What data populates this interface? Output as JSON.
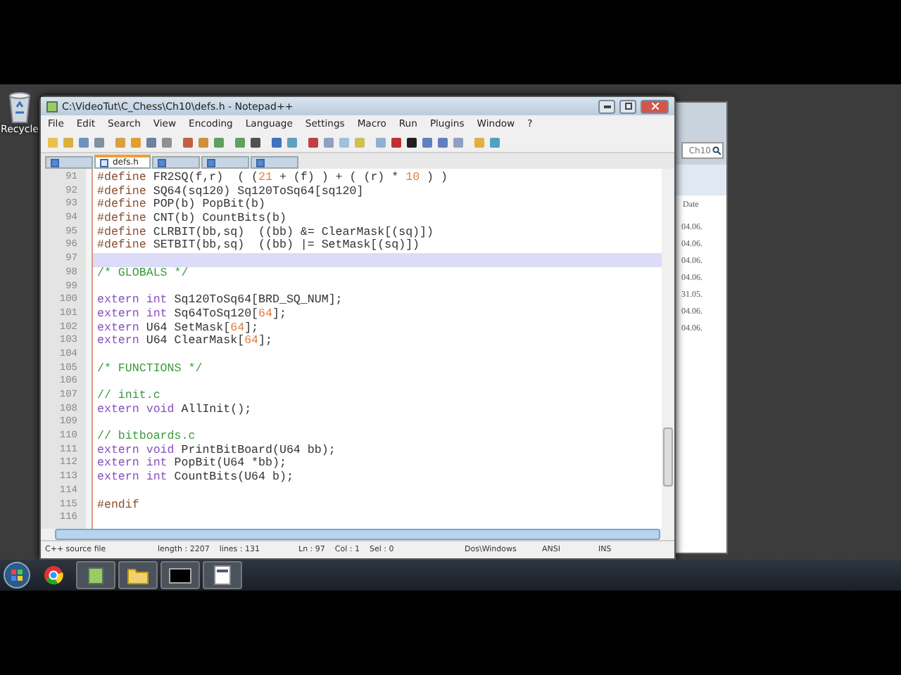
{
  "desktop": {
    "icons": [
      {
        "label": "Recycle"
      }
    ]
  },
  "background_window": {
    "search": "Ch10",
    "column_header": "Date",
    "dates": [
      "04.06.",
      "04.06.",
      "04.06.",
      "04.06.",
      "31.05.",
      "04.06.",
      "04.06."
    ]
  },
  "window": {
    "title": "C:\\VideoTut\\C_Chess\\Ch10\\defs.h - Notepad++"
  },
  "menu": [
    "File",
    "Edit",
    "Search",
    "View",
    "Encoding",
    "Language",
    "Settings",
    "Macro",
    "Run",
    "Plugins",
    "Window",
    "?"
  ],
  "tabs": [
    {
      "selected": false
    },
    {
      "label": "defs.h",
      "selected": true
    },
    {
      "selected": false
    },
    {
      "selected": false
    },
    {
      "selected": false
    }
  ],
  "lines": [
    {
      "num": "91",
      "current": false,
      "segments": [
        {
          "kind": "pre",
          "text": "#define"
        },
        {
          "kind": "plain",
          "text": " FR2SQ(f,r)  ( ("
        },
        {
          "kind": "num",
          "text": "21"
        },
        {
          "kind": "plain",
          "text": " + (f) ) + ( (r) * "
        },
        {
          "kind": "num",
          "text": "10"
        },
        {
          "kind": "plain",
          "text": " ) )"
        }
      ]
    },
    {
      "num": "92",
      "current": false,
      "segments": [
        {
          "kind": "pre",
          "text": "#define"
        },
        {
          "kind": "plain",
          "text": " SQ64(sq120) Sq120ToSq64[sq120]"
        }
      ]
    },
    {
      "num": "93",
      "current": false,
      "segments": [
        {
          "kind": "pre",
          "text": "#define"
        },
        {
          "kind": "plain",
          "text": " POP(b) PopBit(b)"
        }
      ]
    },
    {
      "num": "94",
      "current": false,
      "segments": [
        {
          "kind": "pre",
          "text": "#define"
        },
        {
          "kind": "plain",
          "text": " CNT(b) CountBits(b)"
        }
      ]
    },
    {
      "num": "95",
      "current": false,
      "segments": [
        {
          "kind": "pre",
          "text": "#define"
        },
        {
          "kind": "plain",
          "text": " CLRBIT(bb,sq)  ((bb) &= ClearMask[(sq)])"
        }
      ]
    },
    {
      "num": "96",
      "current": false,
      "segments": [
        {
          "kind": "pre",
          "text": "#define"
        },
        {
          "kind": "plain",
          "text": " SETBIT(bb,sq)  ((bb) |= SetMask[(sq)])"
        }
      ]
    },
    {
      "num": "97",
      "current": true
    },
    {
      "num": "98",
      "current": false,
      "segments": [
        {
          "kind": "comment",
          "text": "/* GLOBALS */"
        }
      ]
    },
    {
      "num": "99",
      "current": false
    },
    {
      "num": "100",
      "current": false,
      "segments": [
        {
          "kind": "kw",
          "text": "extern"
        },
        {
          "kind": "kw",
          "text": " int"
        },
        {
          "kind": "plain",
          "text": " Sq120ToSq64[BRD_SQ_NUM];"
        }
      ]
    },
    {
      "num": "101",
      "current": false,
      "segments": [
        {
          "kind": "kw",
          "text": "extern"
        },
        {
          "kind": "kw",
          "text": " int"
        },
        {
          "kind": "plain",
          "text": " Sq64ToSq120["
        },
        {
          "kind": "num",
          "text": "64"
        },
        {
          "kind": "plain",
          "text": "];"
        }
      ]
    },
    {
      "num": "102",
      "current": false,
      "segments": [
        {
          "kind": "kw",
          "text": "extern"
        },
        {
          "kind": "plain",
          "text": " U64 SetMask["
        },
        {
          "kind": "num",
          "text": "64"
        },
        {
          "kind": "plain",
          "text": "];"
        }
      ]
    },
    {
      "num": "103",
      "current": false,
      "segments": [
        {
          "kind": "kw",
          "text": "extern"
        },
        {
          "kind": "plain",
          "text": " U64 ClearMask["
        },
        {
          "kind": "num",
          "text": "64"
        },
        {
          "kind": "plain",
          "text": "];"
        }
      ]
    },
    {
      "num": "104",
      "current": false
    },
    {
      "num": "105",
      "current": false,
      "segments": [
        {
          "kind": "comment",
          "text": "/* FUNCTIONS */"
        }
      ]
    },
    {
      "num": "106",
      "current": false
    },
    {
      "num": "107",
      "current": false,
      "segments": [
        {
          "kind": "comment",
          "text": "// init.c"
        }
      ]
    },
    {
      "num": "108",
      "current": false,
      "segments": [
        {
          "kind": "kw",
          "text": "extern"
        },
        {
          "kind": "kw",
          "text": " void"
        },
        {
          "kind": "plain",
          "text": " AllInit();"
        }
      ]
    },
    {
      "num": "109",
      "current": false
    },
    {
      "num": "110",
      "current": false,
      "segments": [
        {
          "kind": "comment",
          "text": "// bitboards.c"
        }
      ]
    },
    {
      "num": "111",
      "current": false,
      "segments": [
        {
          "kind": "kw",
          "text": "extern"
        },
        {
          "kind": "kw",
          "text": " void"
        },
        {
          "kind": "plain",
          "text": " PrintBitBoard(U64 bb);"
        }
      ]
    },
    {
      "num": "112",
      "current": false,
      "segments": [
        {
          "kind": "kw",
          "text": "extern"
        },
        {
          "kind": "kw",
          "text": " int"
        },
        {
          "kind": "plain",
          "text": " PopBit(U64 *bb);"
        }
      ]
    },
    {
      "num": "113",
      "current": false,
      "segments": [
        {
          "kind": "kw",
          "text": "extern"
        },
        {
          "kind": "kw",
          "text": " int"
        },
        {
          "kind": "plain",
          "text": " CountBits(U64 b);"
        }
      ]
    },
    {
      "num": "114",
      "current": false
    },
    {
      "num": "115",
      "current": false,
      "segments": [
        {
          "kind": "pre",
          "text": "#endif"
        }
      ]
    },
    {
      "num": "116",
      "current": false
    }
  ],
  "status_bar": [
    "C++ source file",
    "length : 2207    lines : 131",
    "Ln : 97    Col : 1    Sel : 0",
    "Dos\\Windows",
    "ANSI",
    "INS"
  ]
}
